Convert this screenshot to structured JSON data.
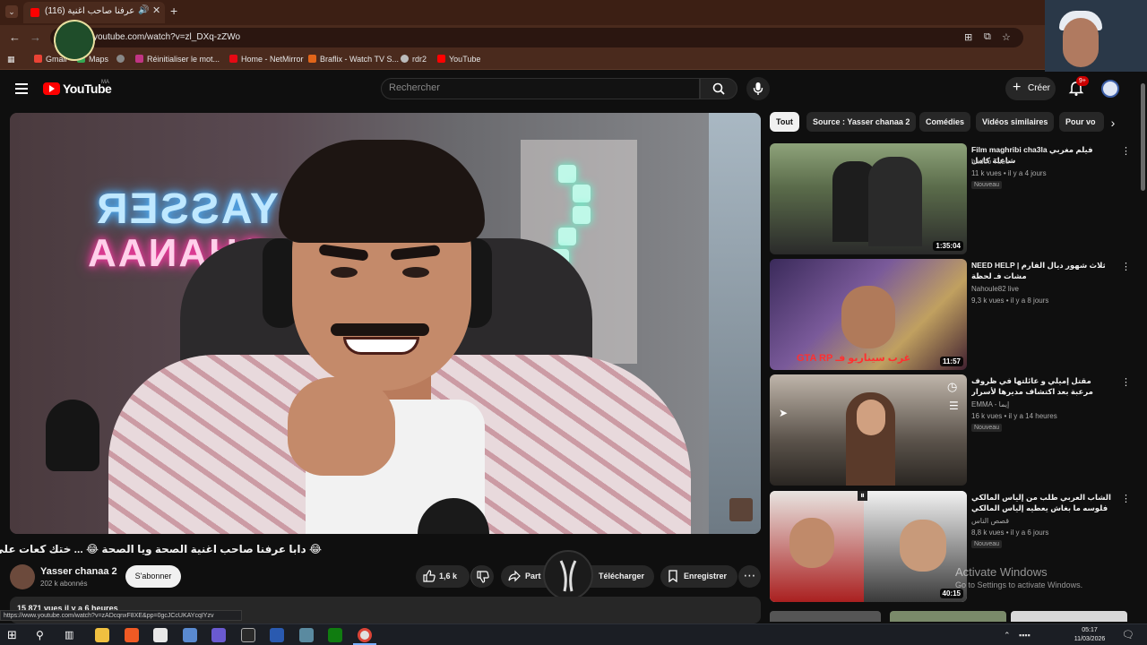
{
  "browser": {
    "tab_title": "(116) دابا عرفنا صاحب اغنية",
    "url": "youtube.com/watch?v=zl_DXq-zZWo",
    "bookmarks": [
      {
        "label": "Gmail",
        "color": "#ea4335"
      },
      {
        "label": "Maps",
        "color": "#34a853"
      },
      {
        "label": "",
        "color": "#888888"
      },
      {
        "label": "Réinitialiser le mot...",
        "color": "#c13584"
      },
      {
        "label": "Home - NetMirror",
        "color": "#e50914"
      },
      {
        "label": "Braflix - Watch TV S...",
        "color": "#e0651a"
      },
      {
        "label": "rdr2",
        "color": "#bbbbbb"
      },
      {
        "label": "YouTube",
        "color": "#ff0000"
      }
    ],
    "status_url": "https://www.youtube.com/watch?v=zADcqnxF8XE&pp=0gcJCcUKAYcqIYzv"
  },
  "youtube": {
    "logo_text": "YouTube",
    "logo_country": "MA",
    "search_placeholder": "Rechercher",
    "create_label": "Créer",
    "notif_count": "9+"
  },
  "video": {
    "neon_line1": "YASSER",
    "neon_line2": "CHANAA",
    "title": "😂 دابا عرفنا صاحب اغنية الصحة ويا الصحة 😂 ... ختك كعات على المتابعين",
    "channel_name": "Yasser chanaa 2",
    "subscribers": "202 k abonnés",
    "subscribe_label": "S'abonner",
    "likes": "1,6 k",
    "share_label": "Part",
    "download_label": "Télécharger",
    "save_label": "Enregistrer",
    "views_line": "15 871 vues  il y a 6 heures"
  },
  "chips": [
    {
      "label": "Tout",
      "active": true
    },
    {
      "label": "Source : Yasser chanaa 2",
      "active": false
    },
    {
      "label": "Comédies",
      "active": false
    },
    {
      "label": "Vidéos similaires",
      "active": false
    },
    {
      "label": "Pour vo",
      "active": false
    }
  ],
  "recommendations": [
    {
      "title": "Film maghribi cha3la فيلم مغربي شاعلة كامل",
      "channel": "badoo Tube",
      "meta": "11 k vues • il y a 4 jours",
      "badge": "Nouveau",
      "duration": "1:35:04",
      "thumb_color": "#3c4a3a"
    },
    {
      "title": "NEED HELP | ثلاث شهور ديال الفارم مشات فـ لحظة",
      "channel": "Nahoule82 live",
      "meta": "9,3 k vues • il y a 8 jours",
      "badge": "",
      "duration": "11:57",
      "thumb_color": "#5a4060",
      "thumb_caption": "غرب سيناريو فـ GTA RP"
    },
    {
      "title": "مقتل إميلي و عائلتها في ظروف مرعبة بعد اكتشاف مديرها لأسرار خطيرة 🔥 قصة للعبرة",
      "channel": "EMMA - إيما",
      "meta": "16 k vues • il y a 14 heures",
      "badge": "Nouveau",
      "duration": "",
      "thumb_color": "#4a4440"
    },
    {
      "title": "الشاب العربي طلب من إلياس المالكي فلوسه ما بغاش يعطيه إلياس المالكي الموت ديال الضحك",
      "channel": "قصص الناس",
      "meta": "8,8 k vues • il y a 6 jours",
      "badge": "Nouveau",
      "duration": "40:15",
      "thumb_color": "#7a3030"
    }
  ],
  "windows_notice": {
    "line1": "Activate Windows",
    "line2": "Go to Settings to activate Windows."
  },
  "taskbar": {
    "time": "05:17",
    "date": "11/03/2026"
  }
}
